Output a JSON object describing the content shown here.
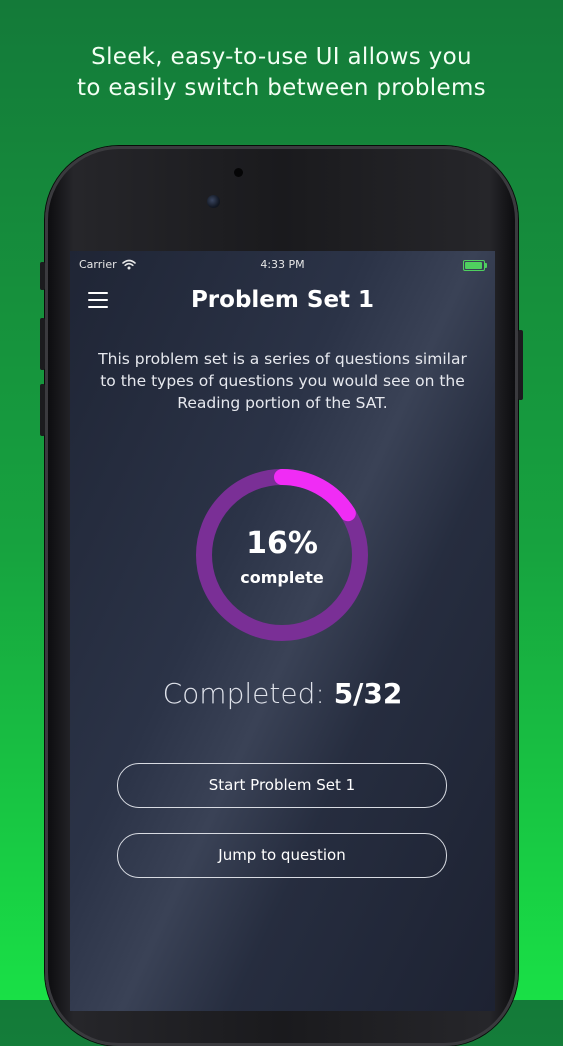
{
  "promo": {
    "tagline_line1": "Sleek, easy-to-use UI allows you",
    "tagline_line2": "to easily switch between problems"
  },
  "status_bar": {
    "carrier": "Carrier",
    "time": "4:33 PM",
    "wifi_icon": "wifi-icon",
    "battery_icon": "battery-icon",
    "battery_color": "#4fd05f"
  },
  "nav": {
    "menu_icon": "hamburger-menu-icon",
    "title": "Problem Set 1"
  },
  "main": {
    "description": "This problem set is a series of questions similar to the types of questions you would see on the Reading portion of the SAT.",
    "progress": {
      "percent_text": "16%",
      "label": "complete",
      "fraction": 0.16,
      "track_color": "#7a2f96",
      "fill_color": "#f02cf5"
    },
    "completed_label": "Completed:",
    "completed_value": "5/32"
  },
  "buttons": {
    "start_label": "Start Problem Set 1",
    "jump_label": "Jump to question"
  },
  "colors": {
    "background_top": "#147a39",
    "background_bottom": "#19e046",
    "screen_bg": "#262d3f"
  }
}
